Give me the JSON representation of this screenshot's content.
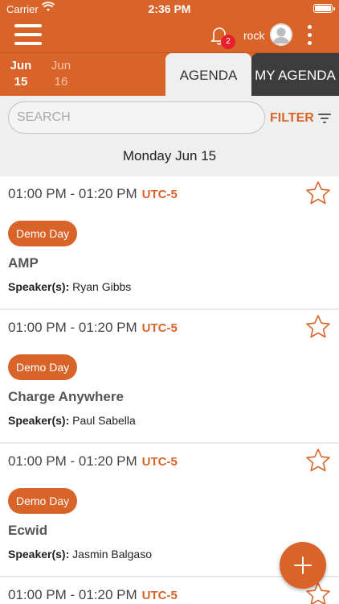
{
  "status_bar": {
    "carrier": "Carrier",
    "time": "2:36 PM"
  },
  "header": {
    "notification_count": "2",
    "username": "rock"
  },
  "dates": [
    {
      "month": "Jun",
      "day": "15",
      "active": true
    },
    {
      "month": "Jun",
      "day": "16",
      "active": false
    }
  ],
  "tabs": {
    "agenda": "AGENDA",
    "my_agenda": "MY AGENDA"
  },
  "search": {
    "placeholder": "SEARCH",
    "value": ""
  },
  "filter_label": "FILTER",
  "day_header": "Monday Jun 15",
  "sessions": [
    {
      "time": "01:00 PM - 01:20 PM",
      "tz": "UTC-5",
      "tag": "Demo Day",
      "title": "AMP",
      "speaker_label": "Speaker(s):",
      "speaker": "Ryan Gibbs"
    },
    {
      "time": "01:00 PM - 01:20 PM",
      "tz": "UTC-5",
      "tag": "Demo Day",
      "title": "Charge Anywhere",
      "speaker_label": "Speaker(s):",
      "speaker": "Paul Sabella"
    },
    {
      "time": "01:00 PM - 01:20 PM",
      "tz": "UTC-5",
      "tag": "Demo Day",
      "title": "Ecwid",
      "speaker_label": "Speaker(s):",
      "speaker": "Jasmin Balgaso"
    },
    {
      "time": "01:00 PM - 01:20 PM",
      "tz": "UTC-5"
    }
  ],
  "icons": {
    "menu": "hamburger-menu-icon",
    "bell": "bell-icon",
    "avatar": "user-avatar-icon",
    "more": "more-vertical-icon",
    "filter": "filter-lines-icon",
    "star": "star-outline-icon",
    "fab": "plus-icon"
  },
  "colors": {
    "accent": "#d9642a",
    "dark_tab": "#3d3d3d",
    "badge": "#e5202a"
  }
}
